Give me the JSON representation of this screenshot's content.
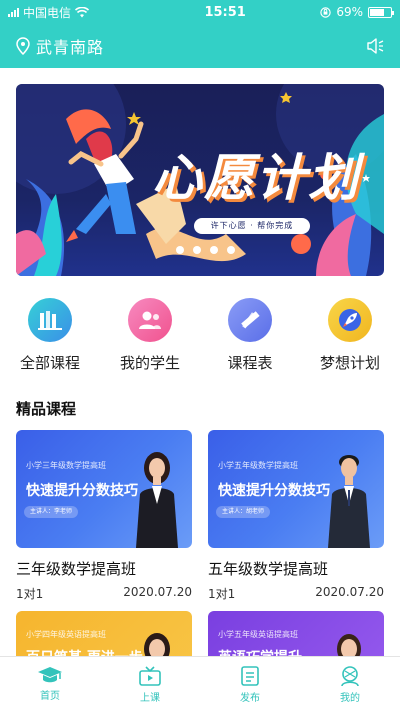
{
  "status_bar": {
    "carrier": "中国电信",
    "time": "15:51",
    "battery": "69%",
    "battery_level": 0.69
  },
  "header": {
    "location": "武青南路"
  },
  "banner": {
    "title": "心愿计划",
    "tagline": "许下心愿 · 帮你完成",
    "pages": 4,
    "active_page": 0
  },
  "menu": [
    {
      "label": "全部课程",
      "icon": "books-icon",
      "color": "#3bbfe0"
    },
    {
      "label": "我的学生",
      "icon": "students-icon",
      "color": "#f06aa0"
    },
    {
      "label": "课程表",
      "icon": "ruler-pencil-icon",
      "color": "#6b7df0"
    },
    {
      "label": "梦想计划",
      "icon": "rocket-icon",
      "color": "#f6c531"
    }
  ],
  "section": {
    "title": "精品课程"
  },
  "courses": [
    {
      "thumb_subtitle": "小学三年级数学提高班",
      "thumb_title": "快速提升分数技巧",
      "teacher": "主讲人：李老师",
      "title": "三年级数学提高班",
      "type": "1对1",
      "date": "2020.07.20"
    },
    {
      "thumb_subtitle": "小学五年级数学提高班",
      "thumb_title": "快速提升分数技巧",
      "teacher": "主讲人：胡老师",
      "title": "五年级数学提高班",
      "type": "1对1",
      "date": "2020.07.20"
    },
    {
      "thumb_subtitle": "小学四年级英语提高班",
      "thumb_title": "百日筑基 更进一步"
    },
    {
      "thumb_subtitle": "小学五年级英语提高班",
      "thumb_title": "英语巧学提升"
    }
  ],
  "tabs": [
    {
      "label": "首页",
      "icon": "graduation-cap-icon"
    },
    {
      "label": "上课",
      "icon": "tv-icon"
    },
    {
      "label": "发布",
      "icon": "document-icon"
    },
    {
      "label": "我的",
      "icon": "person-icon"
    }
  ],
  "colors": {
    "accent": "#33d0c6",
    "tab_active": "#33c3bb"
  }
}
